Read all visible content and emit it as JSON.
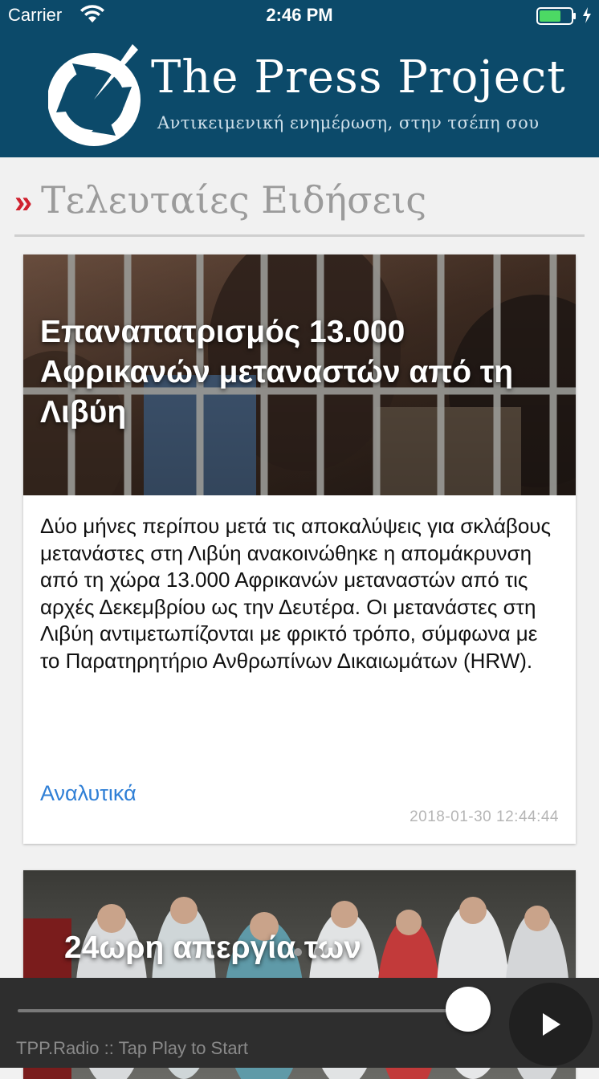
{
  "status_bar": {
    "carrier": "Carrier",
    "time": "2:46 PM",
    "icons": [
      "wifi-icon",
      "battery-icon",
      "charging-icon"
    ]
  },
  "header": {
    "background_color": "#0c4a6a",
    "logo_icon": "press-project-logo-icon",
    "title": "The Press Project",
    "tagline": "Αντικειμενική ενημέρωση, στην τσέπη σου"
  },
  "section": {
    "marker": "»",
    "marker_color": "#d0222f",
    "title": "Τελευταίες Ειδήσεις"
  },
  "articles": [
    {
      "headline": "Επαναπατρισμός 13.000 Αφρικανών μεταναστών από τη Λιβύη",
      "summary": "Δύο μήνες περίπου μετά τις αποκαλύψεις για σκλάβους μετανάστες στη Λιβύη ανακοινώθηκε η απομάκρυνση από τη χώρα 13.000 Αφρικανών μεταναστών από τις αρχές Δεκεμβρίου ως την Δευτέρα. Οι μετανάστες στη Λιβύη αντιμετωπίζονται με φρικτό τρόπο, σύμφωνα με το Παρατηρητήριο Ανθρωπίνων Δικαιωμάτων (HRW).",
      "link_label": "Αναλυτικά",
      "date": "2018-01-30 12:44:44"
    },
    {
      "headline": "24ωρη απεργία των"
    }
  ],
  "player": {
    "status": "TPP.Radio :: Tap Play to Start",
    "play_icon": "play-icon",
    "progress": 1.0
  },
  "accent_link_color": "#2f7fd6"
}
